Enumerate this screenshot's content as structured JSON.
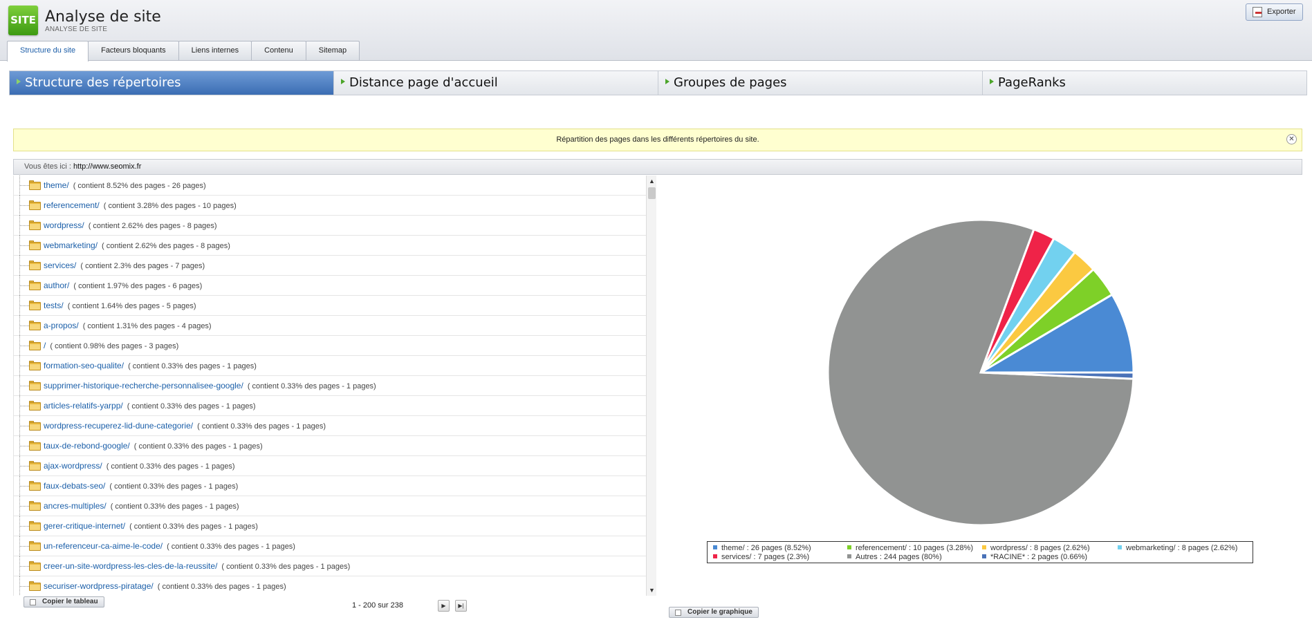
{
  "app": {
    "logo_text": "SITE",
    "title": "Analyse de site",
    "subtitle": "ANALYSE DE SITE",
    "export_label": "Exporter"
  },
  "tabs": [
    {
      "label": "Structure du site",
      "active": true
    },
    {
      "label": "Facteurs bloquants",
      "active": false
    },
    {
      "label": "Liens internes",
      "active": false
    },
    {
      "label": "Contenu",
      "active": false
    },
    {
      "label": "Sitemap",
      "active": false
    }
  ],
  "sections": [
    {
      "label": "Structure des répertoires",
      "active": true
    },
    {
      "label": "Distance page d'accueil",
      "active": false
    },
    {
      "label": "Groupes de pages",
      "active": false
    },
    {
      "label": "PageRanks",
      "active": false
    }
  ],
  "notice": {
    "text": "Répartition des pages dans les différents répertoires du site.",
    "close_glyph": "✕"
  },
  "breadcrumb": {
    "label": "Vous êtes ici : ",
    "url": "http://www.seomix.fr"
  },
  "directories": [
    {
      "name": "theme/",
      "info": "( contient 8.52% des pages - 26 pages)"
    },
    {
      "name": "referencement/",
      "info": "( contient 3.28% des pages - 10 pages)"
    },
    {
      "name": "wordpress/",
      "info": "( contient 2.62% des pages - 8 pages)"
    },
    {
      "name": "webmarketing/",
      "info": "( contient 2.62% des pages - 8 pages)"
    },
    {
      "name": "services/",
      "info": "( contient 2.3% des pages - 7 pages)"
    },
    {
      "name": "author/",
      "info": "( contient 1.97% des pages - 6 pages)"
    },
    {
      "name": "tests/",
      "info": "( contient 1.64% des pages - 5 pages)"
    },
    {
      "name": "a-propos/",
      "info": "( contient 1.31% des pages - 4 pages)"
    },
    {
      "name": "/",
      "info": "( contient 0.98% des pages - 3 pages)"
    },
    {
      "name": "formation-seo-qualite/",
      "info": "( contient 0.33% des pages - 1 pages)"
    },
    {
      "name": "supprimer-historique-recherche-personnalisee-google/",
      "info": "( contient 0.33% des pages - 1 pages)"
    },
    {
      "name": "articles-relatifs-yarpp/",
      "info": "( contient 0.33% des pages - 1 pages)"
    },
    {
      "name": "wordpress-recuperez-lid-dune-categorie/",
      "info": "( contient 0.33% des pages - 1 pages)"
    },
    {
      "name": "taux-de-rebond-google/",
      "info": "( contient 0.33% des pages - 1 pages)"
    },
    {
      "name": "ajax-wordpress/",
      "info": "( contient 0.33% des pages - 1 pages)"
    },
    {
      "name": "faux-debats-seo/",
      "info": "( contient 0.33% des pages - 1 pages)"
    },
    {
      "name": "ancres-multiples/",
      "info": "( contient 0.33% des pages - 1 pages)"
    },
    {
      "name": "gerer-critique-internet/",
      "info": "( contient 0.33% des pages - 1 pages)"
    },
    {
      "name": "un-referenceur-ca-aime-le-code/",
      "info": "( contient 0.33% des pages - 1 pages)"
    },
    {
      "name": "creer-un-site-wordpress-les-cles-de-la-reussite/",
      "info": "( contient 0.33% des pages - 1 pages)"
    },
    {
      "name": "securiser-wordpress-piratage/",
      "info": "( contient 0.33% des pages - 1 pages)"
    }
  ],
  "scroll": {
    "up": "▲",
    "down": "▼"
  },
  "pager": {
    "copy_table_label": "Copier le tableau",
    "range_text": "1 - 200 sur 238",
    "next_glyph": "▶",
    "last_glyph": "▶|"
  },
  "chart_copy_label": "Copier le graphique",
  "chart_data": {
    "type": "pie",
    "title": "",
    "series": [
      {
        "name": "theme/",
        "label": "theme/ :  26 pages (8.52%)",
        "value": 26,
        "percent": 8.52,
        "color": "#4a8ad4"
      },
      {
        "name": "referencement/",
        "label": "referencement/ :  10 pages (3.28%)",
        "value": 10,
        "percent": 3.28,
        "color": "#7ed028"
      },
      {
        "name": "wordpress/",
        "label": "wordpress/ :  8 pages (2.62%)",
        "value": 8,
        "percent": 2.62,
        "color": "#fbc941"
      },
      {
        "name": "webmarketing/",
        "label": "webmarketing/ :  8 pages (2.62%)",
        "value": 8,
        "percent": 2.62,
        "color": "#72d1ef"
      },
      {
        "name": "services/",
        "label": "services/ :  7 pages (2.3%)",
        "value": 7,
        "percent": 2.3,
        "color": "#ef2348"
      },
      {
        "name": "Autres",
        "label": "Autres :  244 pages (80%)",
        "value": 244,
        "percent": 80,
        "color": "#919392"
      },
      {
        "name": "*RACINE*",
        "label": "*RACINE* :  2 pages (0.66%)",
        "value": 2,
        "percent": 0.66,
        "color": "#4a72b8"
      }
    ],
    "legend": "bottom"
  }
}
